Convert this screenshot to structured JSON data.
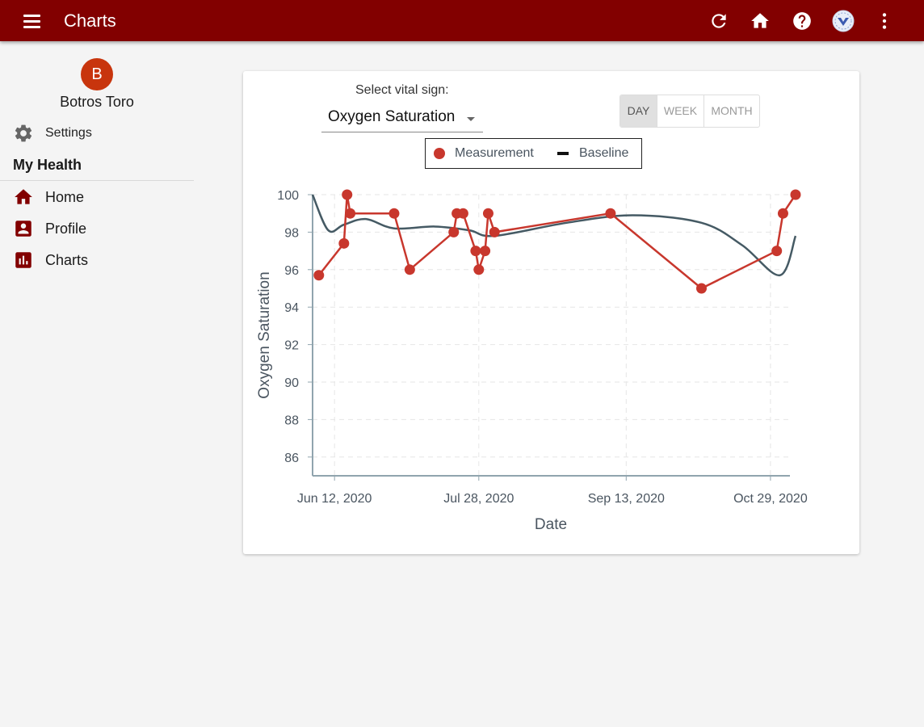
{
  "appbar": {
    "title": "Charts",
    "color": "#820000",
    "icons": [
      "menu-icon",
      "refresh-icon",
      "home-icon",
      "help-icon",
      "app-logo-icon",
      "more-vert-icon"
    ]
  },
  "sidebar": {
    "avatar_initial": "B",
    "avatar_color": "#c8350d",
    "user_name": "Botros Toro",
    "settings_label": "Settings",
    "section_title": "My Health",
    "items": [
      {
        "label": "Home",
        "icon": "home-icon"
      },
      {
        "label": "Profile",
        "icon": "profile-icon"
      },
      {
        "label": "Charts",
        "icon": "chart-icon"
      }
    ]
  },
  "controls": {
    "select_label": "Select vital sign:",
    "selected_vital": "Oxygen Saturation",
    "ranges": [
      "DAY",
      "WEEK",
      "MONTH"
    ],
    "active_range": "DAY"
  },
  "legend": {
    "measurement": "Measurement",
    "baseline": "Baseline"
  },
  "chart_data": {
    "type": "line",
    "xlabel": "Date",
    "ylabel": "Oxygen Saturation",
    "x_ticks": [
      "Jun 12, 2020",
      "Jul 28, 2020",
      "Sep 13, 2020",
      "Oct 29, 2020"
    ],
    "x_range": [
      "2020-06-05",
      "2020-11-05"
    ],
    "ylim": [
      85,
      100
    ],
    "y_ticks": [
      86,
      88,
      90,
      92,
      94,
      96,
      98,
      100
    ],
    "grid": true,
    "legend_position": "top-center",
    "series": [
      {
        "name": "Measurement",
        "color": "#c8372d",
        "points": [
          {
            "x": "2020-06-07",
            "y": 95.7
          },
          {
            "x": "2020-06-15",
            "y": 97.4
          },
          {
            "x": "2020-06-16",
            "y": 100
          },
          {
            "x": "2020-06-17",
            "y": 99
          },
          {
            "x": "2020-07-01",
            "y": 99
          },
          {
            "x": "2020-07-06",
            "y": 96
          },
          {
            "x": "2020-07-20",
            "y": 98
          },
          {
            "x": "2020-07-21",
            "y": 99
          },
          {
            "x": "2020-07-23",
            "y": 99
          },
          {
            "x": "2020-07-27",
            "y": 97
          },
          {
            "x": "2020-07-28",
            "y": 96
          },
          {
            "x": "2020-07-30",
            "y": 97
          },
          {
            "x": "2020-07-31",
            "y": 99
          },
          {
            "x": "2020-08-02",
            "y": 98
          },
          {
            "x": "2020-09-08",
            "y": 99
          },
          {
            "x": "2020-10-07",
            "y": 95
          },
          {
            "x": "2020-10-31",
            "y": 97
          },
          {
            "x": "2020-11-02",
            "y": 99
          },
          {
            "x": "2020-11-06",
            "y": 100
          }
        ]
      },
      {
        "name": "Baseline",
        "color": "#455a64",
        "points": [
          {
            "x": "2020-06-05",
            "y": 100
          },
          {
            "x": "2020-06-10",
            "y": 98.1
          },
          {
            "x": "2020-06-15",
            "y": 98.4
          },
          {
            "x": "2020-06-22",
            "y": 98.7
          },
          {
            "x": "2020-07-01",
            "y": 98.2
          },
          {
            "x": "2020-07-14",
            "y": 98.3
          },
          {
            "x": "2020-07-25",
            "y": 98.1
          },
          {
            "x": "2020-08-02",
            "y": 97.8
          },
          {
            "x": "2020-08-25",
            "y": 98.5
          },
          {
            "x": "2020-09-15",
            "y": 98.9
          },
          {
            "x": "2020-10-07",
            "y": 98.5
          },
          {
            "x": "2020-10-20",
            "y": 97.3
          },
          {
            "x": "2020-11-01",
            "y": 95.7
          },
          {
            "x": "2020-11-06",
            "y": 97.8
          }
        ]
      }
    ]
  }
}
